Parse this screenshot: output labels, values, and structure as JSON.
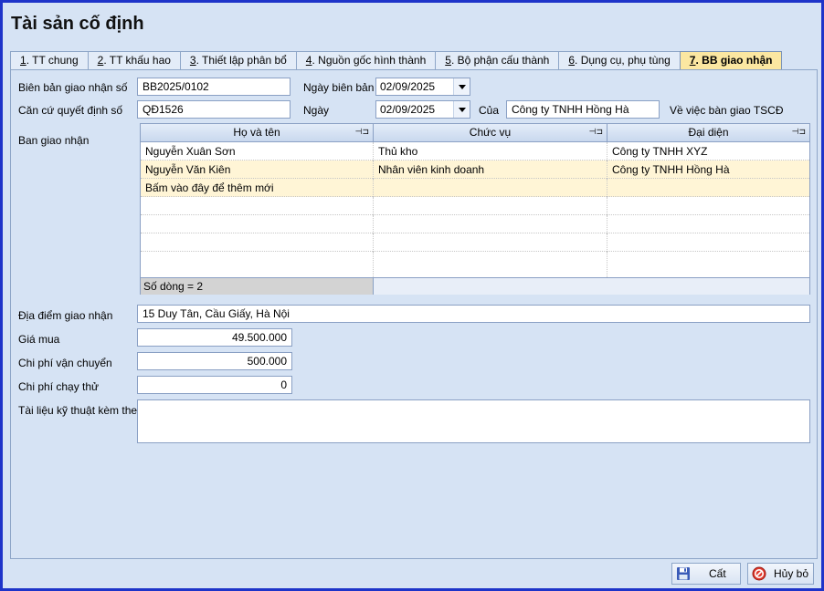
{
  "window": {
    "title": "Tài sản cố định"
  },
  "tabs": [
    {
      "num": "1",
      "label": ". TT chung"
    },
    {
      "num": "2",
      "label": ". TT khấu hao"
    },
    {
      "num": "3",
      "label": ". Thiết lập phân bổ"
    },
    {
      "num": "4",
      "label": ". Nguồn gốc hình thành"
    },
    {
      "num": "5",
      "label": ". Bộ phận cấu thành"
    },
    {
      "num": "6",
      "label": ". Dụng cụ, phụ tùng"
    },
    {
      "num": "7",
      "label": ". BB giao nhận"
    }
  ],
  "form": {
    "bien_ban_label": "Biên bản giao nhận số",
    "bien_ban_value": "BB2025/0102",
    "ngay_bien_ban_label": "Ngày biên bản",
    "ngay_bien_ban_value": "02/09/2025",
    "can_cu_label": "Căn cứ quyết định số",
    "can_cu_value": "QĐ1526",
    "ngay_label": "Ngày",
    "ngay_value": "02/09/2025",
    "cua_label": "Của",
    "cua_value": "Công ty TNHH Hồng Hà",
    "ve_viec_label": "Về việc bàn giao TSCĐ",
    "ban_giao_nhan_label": "Ban giao nhận",
    "dia_diem_label": "Địa điểm giao nhận",
    "dia_diem_value": "15 Duy Tân, Cầu Giấy, Hà Nội",
    "gia_mua_label": "Giá mua",
    "gia_mua_value": "49.500.000",
    "van_chuyen_label": "Chi phí vận chuyển",
    "van_chuyen_value": "500.000",
    "chay_thu_label": "Chi phí chạy thử",
    "chay_thu_value": "0",
    "tai_lieu_label": "Tài liệu kỹ thuật kèm theo",
    "tai_lieu_value": ""
  },
  "grid": {
    "columns": [
      "Họ và tên",
      "Chức vụ",
      "Đại diện"
    ],
    "rows": [
      [
        "Nguyễn Xuân Sơn",
        "Thủ kho",
        "Công ty TNHH XYZ"
      ],
      [
        "Nguyễn Văn Kiên",
        "Nhân viên kinh doanh",
        "Công ty TNHH Hồng Hà"
      ]
    ],
    "new_row_text": "Bấm vào đây để thêm mới",
    "footer": "Số dòng = 2"
  },
  "buttons": {
    "save": "Cất",
    "cancel": "Hủy bỏ"
  },
  "icons": {
    "save": "floppy-disk-icon",
    "cancel": "cancel-icon",
    "pin": "pin-icon",
    "dropdown": "chevron-down-icon"
  }
}
